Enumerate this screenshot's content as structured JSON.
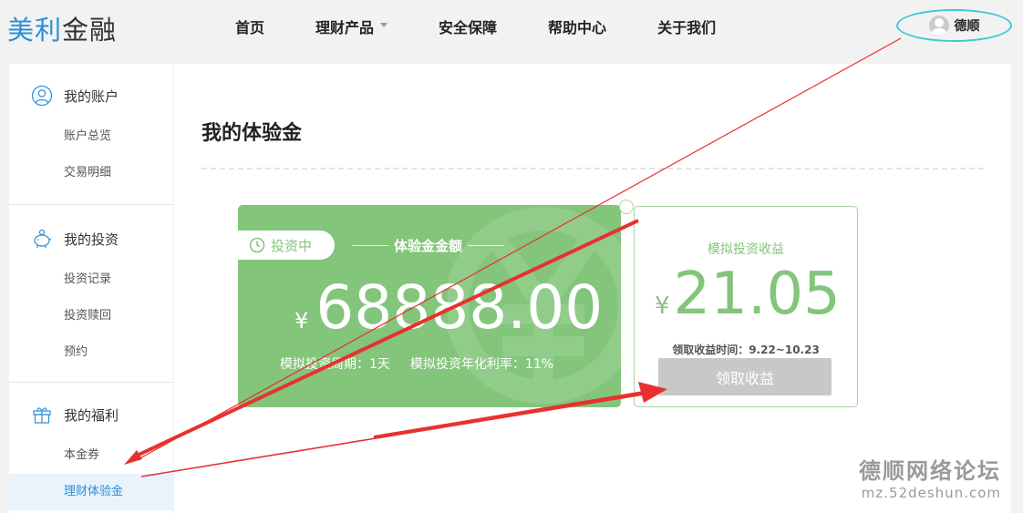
{
  "brand": {
    "part1": "美利",
    "part2": "金融"
  },
  "nav": {
    "items": [
      {
        "label": "首页"
      },
      {
        "label": "理财产品"
      },
      {
        "label": "安全保障"
      },
      {
        "label": "帮助中心"
      },
      {
        "label": "关于我们"
      }
    ],
    "user_name": "德顺"
  },
  "sidebar": {
    "groups": [
      {
        "title": "我的账户",
        "icon": "user-circle-icon",
        "items": [
          "账户总览",
          "交易明细"
        ]
      },
      {
        "title": "我的投资",
        "icon": "piggy-bank-icon",
        "items": [
          "投资记录",
          "投资赎回",
          "预约"
        ]
      },
      {
        "title": "我的福利",
        "icon": "gift-icon",
        "items": [
          "本金券",
          "理财体验金"
        ],
        "active_item": "理财体验金"
      }
    ]
  },
  "main": {
    "title": "我的体验金",
    "card": {
      "status": "投资中",
      "amount_label": "体验金金额",
      "currency": "¥",
      "amount": "68888.00",
      "period": "模拟投资周期：1天",
      "rate": "模拟投资年化利率：11%"
    },
    "earnings": {
      "title": "模拟投资收益",
      "currency": "¥",
      "value": "21.05",
      "claim_time": "领取收益时间：9.22~10.23",
      "claim_button": "领取收益"
    }
  },
  "watermark": {
    "line1": "德顺网络论坛",
    "line2": "mz.52deshun.com"
  },
  "colors": {
    "accent_blue": "#2a8fd6",
    "green": "#83c57b",
    "highlight_ring": "#3cc8d8",
    "annotation_red": "#e8312f",
    "disabled_button": "#c8c8c8"
  }
}
